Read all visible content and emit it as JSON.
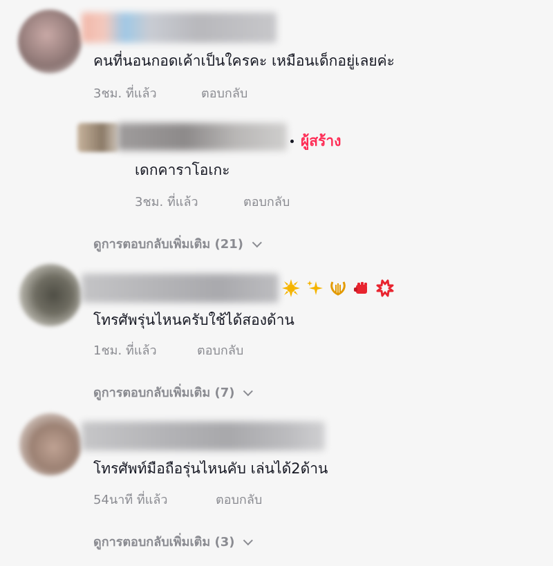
{
  "comments": [
    {
      "text": "คนที่นอนกอดเค้าเป็นใครคะ เหมือนเด็กอยู่เลยค่ะ",
      "time": "3ชม. ที่แล้ว",
      "reply_label": "ตอบกลับ",
      "reply": {
        "creator_tag": "ผู้สร้าง",
        "text": "เดกคาราโอเกะ",
        "time": "3ชม. ที่แล้ว",
        "reply_label": "ตอบกลับ"
      },
      "more_replies": "ดูการตอบกลับเพิ่มเติม (21)"
    },
    {
      "text": "โทรศัพรุ่นไหนครับใช้ได้สองด้าน",
      "time": "1ชม. ที่แล้ว",
      "reply_label": "ตอบกลับ",
      "badges": [
        "sun-badge-icon",
        "sparkle-badge-icon",
        "lyre-badge-icon",
        "fist-badge-icon",
        "anger-badge-icon"
      ],
      "more_replies": "ดูการตอบกลับเพิ่มเติม (7)"
    },
    {
      "text": "โทรศัพท์มือถือรุ่นไหนคับ เล่นได้2ด้าน",
      "time": "54นาที ที่แล้ว",
      "reply_label": "ตอบกลับ",
      "more_replies": "ดูการตอบกลับเพิ่มเติม (3)"
    }
  ],
  "colors": {
    "background": "#f6f6f6",
    "text": "#161823",
    "meta": "#8a8b91",
    "creator": "#fe2c55"
  }
}
